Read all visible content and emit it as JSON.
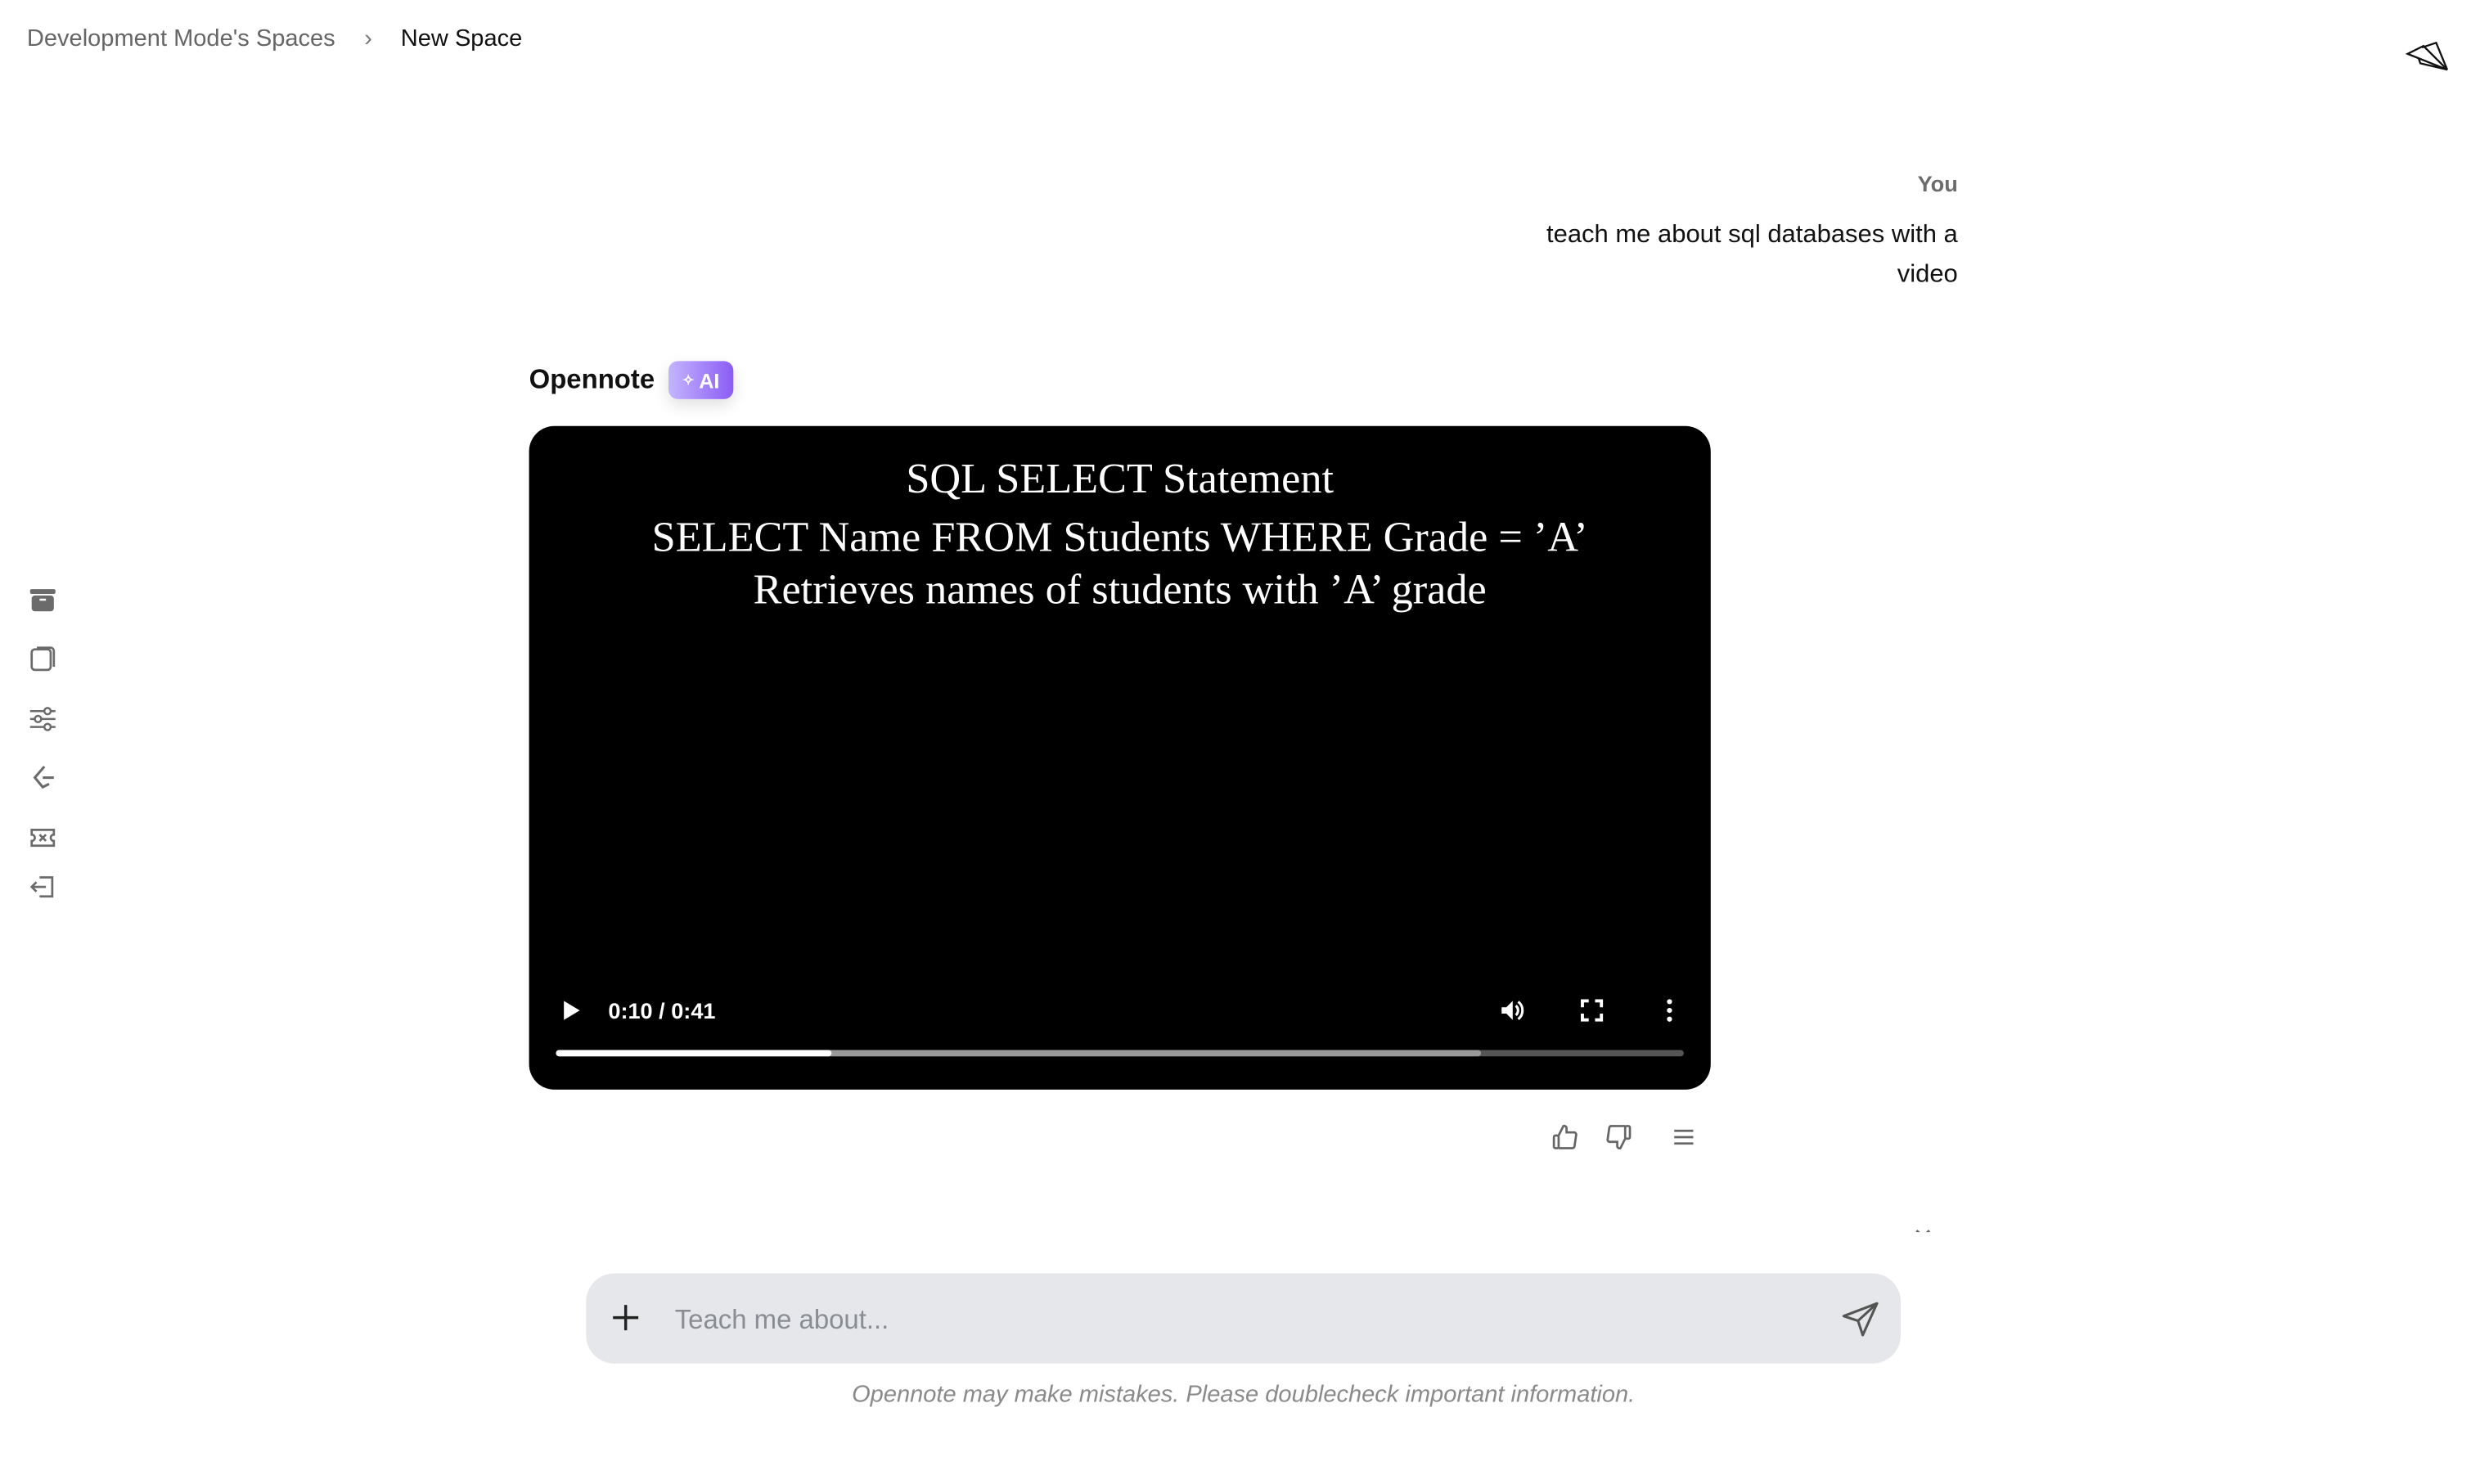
{
  "breadcrumb": {
    "parent": "Development Mode's Spaces",
    "current": "New Space"
  },
  "header": {
    "icon": "paper-plane-icon"
  },
  "sidebar": {
    "icons": [
      "archive-icon",
      "notebook-icon",
      "sliders-icon",
      "eraser-icon",
      "ticket-icon",
      "logout-icon"
    ]
  },
  "user_message": {
    "author": "You",
    "text": "teach me about sql databases with a video"
  },
  "bot_message": {
    "author": "Opennote",
    "badge": "AI",
    "badge_colors": [
      "#c4b5fd",
      "#8b5cf6"
    ]
  },
  "video": {
    "lines": [
      "SQL SELECT Statement",
      "SELECT Name FROM Students WHERE Grade = ’A’",
      "Retrieves names of students with ’A’ grade"
    ],
    "time": "0:10 / 0:41",
    "progress_percent": 24.4,
    "buffered_percent": 82
  },
  "feedback": {
    "icons": [
      "thumbs-up-icon",
      "thumbs-down-icon",
      "menu-icon"
    ]
  },
  "composer": {
    "placeholder": "Teach me about...",
    "value": ""
  },
  "disclaimer": "Opennote may make mistakes. Please doublecheck important information."
}
